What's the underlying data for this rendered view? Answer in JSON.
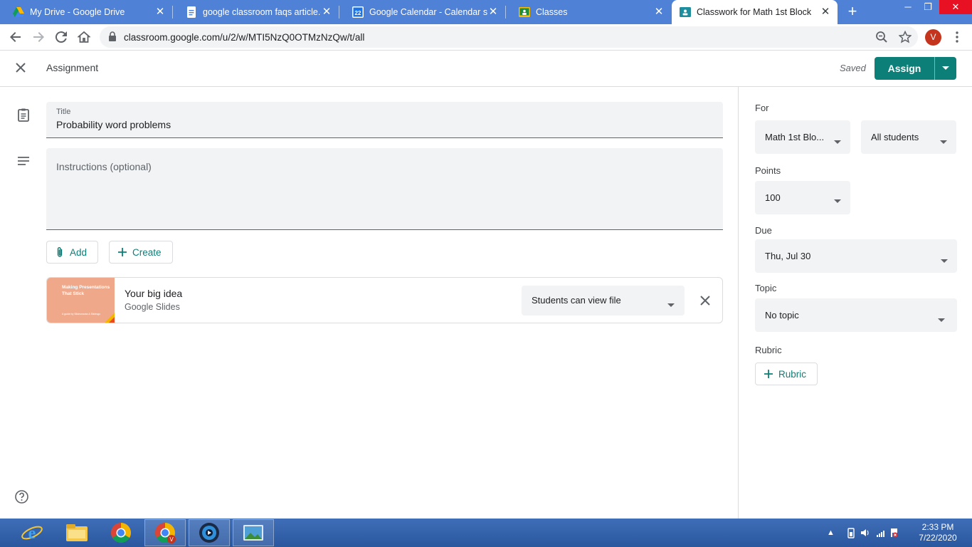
{
  "browser": {
    "tabs": [
      {
        "title": "My Drive - Google Drive",
        "icon": "google-drive-icon"
      },
      {
        "title": "google classroom faqs article.do",
        "icon": "google-docs-icon"
      },
      {
        "title": "Google Calendar - Calendar setti",
        "icon": "google-calendar-icon",
        "icon_text": "22"
      },
      {
        "title": "Classes",
        "icon": "google-classroom-icon"
      },
      {
        "title": "Classwork for Math 1st Block",
        "icon": "google-classroom-icon",
        "active": true
      }
    ],
    "url": "classroom.google.com/u/2/w/MTI5NzQ0OTMzNzQw/t/all",
    "profile_initial": "V"
  },
  "header": {
    "title": "Assignment",
    "saved": "Saved",
    "assign_label": "Assign"
  },
  "form": {
    "title_label": "Title",
    "title_value": "Probability word problems",
    "instructions_placeholder": "Instructions (optional)",
    "add_label": "Add",
    "create_label": "Create"
  },
  "attachment": {
    "thumb_title": "Making Presentations That Stick",
    "thumb_sub": "A guide by Slidesmania & Slidesgo",
    "title": "Your big idea",
    "type": "Google Slides",
    "permission": "Students can view file"
  },
  "panel": {
    "for_label": "For",
    "class_value": "Math 1st Blo...",
    "students_value": "All students",
    "points_label": "Points",
    "points_value": "100",
    "due_label": "Due",
    "due_value": "Thu, Jul 30",
    "topic_label": "Topic",
    "topic_value": "No topic",
    "rubric_label": "Rubric",
    "rubric_button": "Rubric"
  },
  "taskbar": {
    "time": "2:33 PM",
    "date": "7/22/2020"
  },
  "colors": {
    "accent": "#0b7f78",
    "tab_strip": "#4f81d6",
    "taskbar": "#2a579e"
  }
}
